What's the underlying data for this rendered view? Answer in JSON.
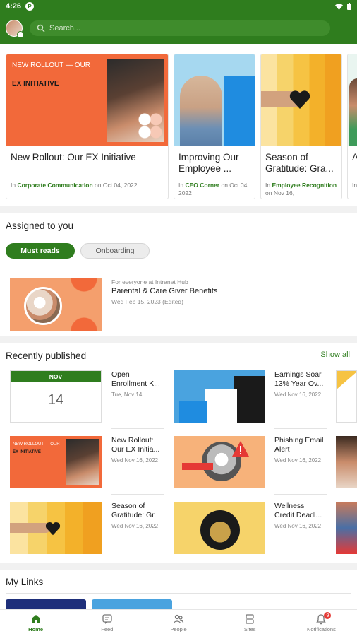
{
  "status_bar": {
    "time": "4:26",
    "badge": "P"
  },
  "search": {
    "placeholder": "Search..."
  },
  "featured": [
    {
      "title": "New Rollout: Our EX Initiative",
      "meta_prefix": "In ",
      "category": "Corporate Communication",
      "meta_suffix": " on Oct 04, 2022",
      "image_text_1": "NEW ROLLOUT — OUR",
      "image_text_2": "EX INITIATIVE"
    },
    {
      "title": "Improving Our Employee ...",
      "meta_prefix": "In ",
      "category": "CEO Corner",
      "meta_suffix": " on Oct 04, 2022"
    },
    {
      "title": "Season of Gratitude: Gra...",
      "meta_prefix": "In ",
      "category": "Employee Recognition",
      "meta_suffix": " on Nov 16,"
    },
    {
      "title": "A M",
      "meta_prefix": "In",
      "category": "",
      "meta_suffix": ""
    }
  ],
  "assigned": {
    "title": "Assigned to you",
    "chips": [
      "Must reads",
      "Onboarding"
    ],
    "item": {
      "pre": "For everyone at Intranet Hub",
      "title": "Parental & Care Giver Benefits",
      "date": "Wed Feb 15, 2023 (Edited)"
    }
  },
  "recently": {
    "title": "Recently published",
    "show_all": "Show all",
    "calendar": {
      "month": "NOV",
      "day": "14"
    },
    "items": [
      {
        "title": "Open Enrollment K...",
        "date": "Tue, Nov 14"
      },
      {
        "title": "Earnings Soar 13% Year Ov...",
        "date": "Wed Nov 16, 2022"
      },
      {
        "title": "New Rollout: Our EX Initia...",
        "date": "Wed Nov 16, 2022"
      },
      {
        "title": "Phishing Email Alert",
        "date": "Wed Nov 16, 2022"
      },
      {
        "title": "Season of Gratitude: Gr...",
        "date": "Wed Nov 16, 2022"
      },
      {
        "title": "Wellness Credit Deadl...",
        "date": "Wed Nov 16, 2022"
      }
    ],
    "mini_text_1": "NEW ROLLOUT — OUR",
    "mini_text_2": "EX INITIATIVE"
  },
  "links": {
    "title": "My Links"
  },
  "nav": [
    {
      "label": "Home",
      "icon": "home-icon"
    },
    {
      "label": "Feed",
      "icon": "feed-icon"
    },
    {
      "label": "People",
      "icon": "people-icon"
    },
    {
      "label": "Sites",
      "icon": "sites-icon"
    },
    {
      "label": "Notifications",
      "icon": "bell-icon",
      "badge": "9"
    }
  ],
  "colors": {
    "brand": "#2f7d1e",
    "orange": "#f2693a",
    "blue": "#4aa3df",
    "yellow": "#f6c343"
  }
}
